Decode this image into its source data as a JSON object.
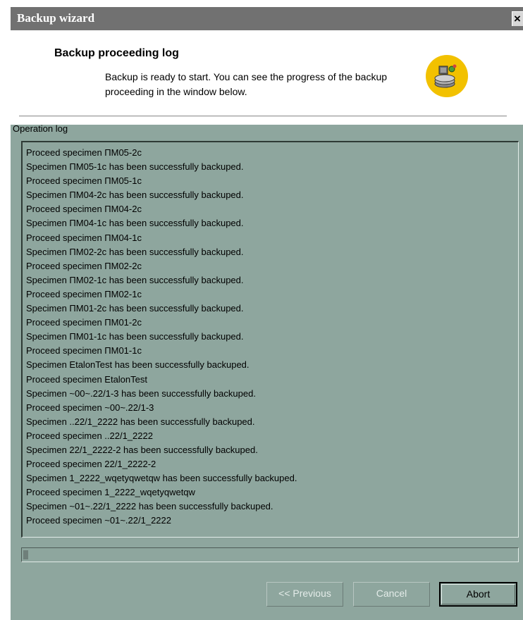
{
  "window": {
    "title": "Backup wizard",
    "close_label": "×"
  },
  "header": {
    "title": "Backup proceeding log",
    "description": "Backup is ready to start. You can see the progress of the backup proceeding in the window below.",
    "icon": "backup-disk-icon"
  },
  "log": {
    "label": "Operation log",
    "lines": [
      "Proceed specimen ПМ05-2с",
      "Specimen ПМ05-1с has been successfully backuped.",
      "Proceed specimen ПМ05-1с",
      "Specimen ПМ04-2с has been successfully backuped.",
      "Proceed specimen ПМ04-2с",
      "Specimen ПМ04-1с has been successfully backuped.",
      "Proceed specimen ПМ04-1с",
      "Specimen ПМ02-2с has been successfully backuped.",
      "Proceed specimen ПМ02-2с",
      "Specimen ПМ02-1с has been successfully backuped.",
      "Proceed specimen ПМ02-1с",
      "Specimen ПМ01-2с has been successfully backuped.",
      "Proceed specimen ПМ01-2с",
      "Specimen ПМ01-1с has been successfully backuped.",
      "Proceed specimen ПМ01-1с",
      "Specimen EtalonTest has been successfully backuped.",
      "Proceed specimen EtalonTest",
      "Specimen ~00~.22/1-3 has been successfully backuped.",
      "Proceed specimen ~00~.22/1-3",
      "Specimen ..22/1_2222 has been successfully backuped.",
      "Proceed specimen ..22/1_2222",
      "Specimen 22/1_2222-2 has been successfully backuped.",
      "Proceed specimen 22/1_2222-2",
      "Specimen 1_2222_wqetyqwetqw has been successfully backuped.",
      "Proceed specimen 1_2222_wqetyqwetqw",
      "Specimen ~01~.22/1_2222 has been successfully backuped.",
      "Proceed specimen ~01~.22/1_2222"
    ]
  },
  "progress": {
    "fraction": 0.01
  },
  "buttons": {
    "previous": "<< Previous",
    "cancel": "Cancel",
    "abort": "Abort"
  }
}
